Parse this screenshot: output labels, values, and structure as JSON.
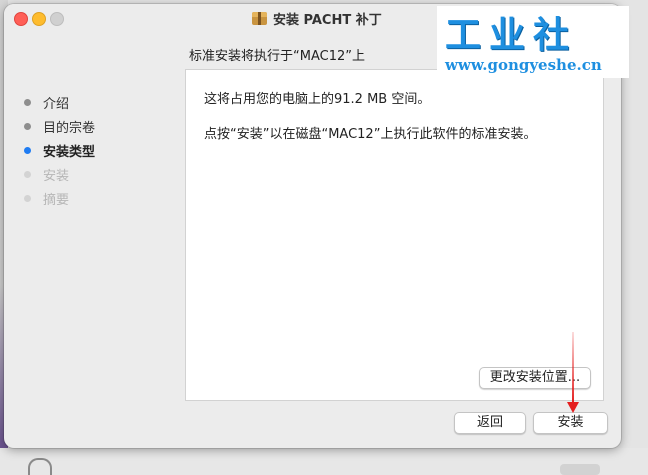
{
  "window": {
    "title": "安装 PACHT 补丁",
    "heading": "标准安装将执行于“MAC12”上"
  },
  "watermark": {
    "text": "工业社",
    "url": "www.gongyeshe.cn"
  },
  "steps": [
    {
      "label": "介绍",
      "state": "done"
    },
    {
      "label": "目的宗卷",
      "state": "done"
    },
    {
      "label": "安装类型",
      "state": "active"
    },
    {
      "label": "安装",
      "state": "pending"
    },
    {
      "label": "摘要",
      "state": "pending"
    }
  ],
  "content": {
    "line1": "这将占用您的电脑上的91.2 MB 空间。",
    "line2": "点按“安装”以在磁盘“MAC12”上执行此软件的标准安装。",
    "change_location_label": "更改安装位置..."
  },
  "buttons": {
    "back_label": "返回",
    "install_label": "安装"
  },
  "colors": {
    "active_step": "#1f7cf2",
    "annotation_arrow": "#e41e1e",
    "close": "#ff5f57",
    "minimize": "#febc2e"
  },
  "icons": {
    "title_icon": "package-icon"
  }
}
